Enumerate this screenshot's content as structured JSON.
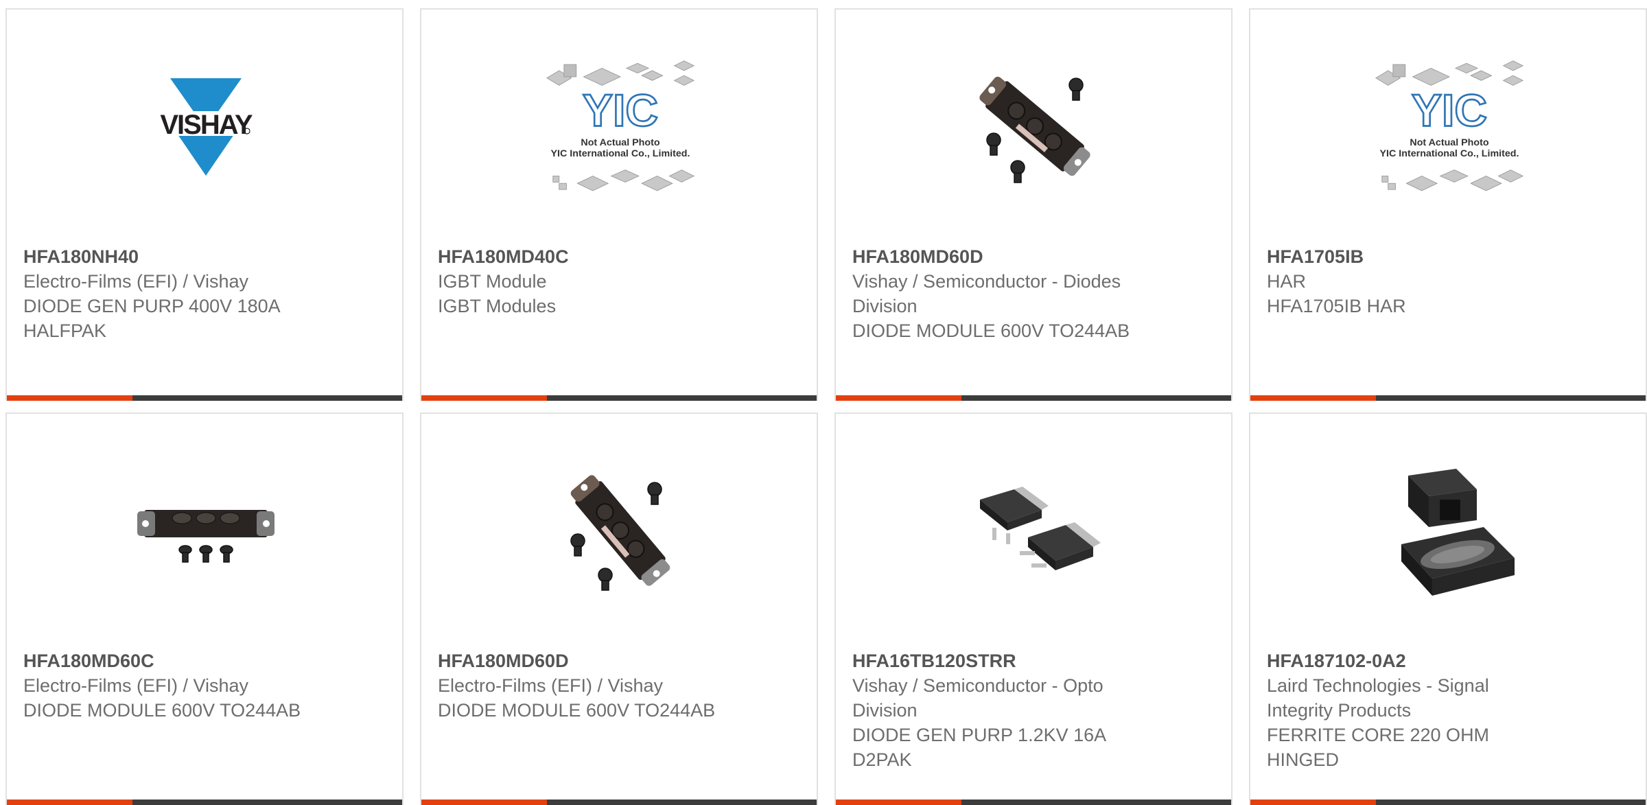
{
  "products": [
    {
      "part_number": "HFA180NH40",
      "manufacturer": "Electro-Films (EFI) / Vishay",
      "description": "DIODE GEN PURP 400V 180A HALFPAK",
      "image": "vishay-logo"
    },
    {
      "part_number": "HFA180MD40C",
      "manufacturer": "IGBT Module",
      "description": "IGBT Modules",
      "image": "yic-placeholder"
    },
    {
      "part_number": "HFA180MD60D",
      "manufacturer": "Vishay / Semiconductor - Diodes Division",
      "description": "DIODE MODULE 600V TO244AB",
      "image": "diode-module-angled"
    },
    {
      "part_number": "HFA1705IB",
      "manufacturer": "HAR",
      "description": "HFA1705IB HAR",
      "image": "yic-placeholder"
    },
    {
      "part_number": "HFA180MD60C",
      "manufacturer": "Electro-Films (EFI) / Vishay",
      "description": "DIODE MODULE 600V TO244AB",
      "image": "diode-module-flat"
    },
    {
      "part_number": "HFA180MD60D",
      "manufacturer": "Electro-Films (EFI) / Vishay",
      "description": "DIODE MODULE 600V TO244AB",
      "image": "diode-module-angled"
    },
    {
      "part_number": "HFA16TB120STRR",
      "manufacturer": "Vishay / Semiconductor - Opto Division",
      "description": "DIODE GEN PURP 1.2KV 16A D2PAK",
      "image": "d2pak-package"
    },
    {
      "part_number": "HFA187102-0A2",
      "manufacturer": "Laird Technologies - Signal Integrity Products",
      "description": "FERRITE CORE 220 OHM HINGED",
      "image": "ferrite-core"
    }
  ],
  "placeholder": {
    "logo_text": "YIC",
    "line1": "Not Actual Photo",
    "line2": "YIC International Co., Limited."
  },
  "vishay_logo_text": "VISHAY",
  "colors": {
    "accent": "#e3400f",
    "bar": "#3c3c3c",
    "border": "#e1e1e1",
    "vishay_blue": "#1f8dcb",
    "text": "#6d6d6d"
  }
}
